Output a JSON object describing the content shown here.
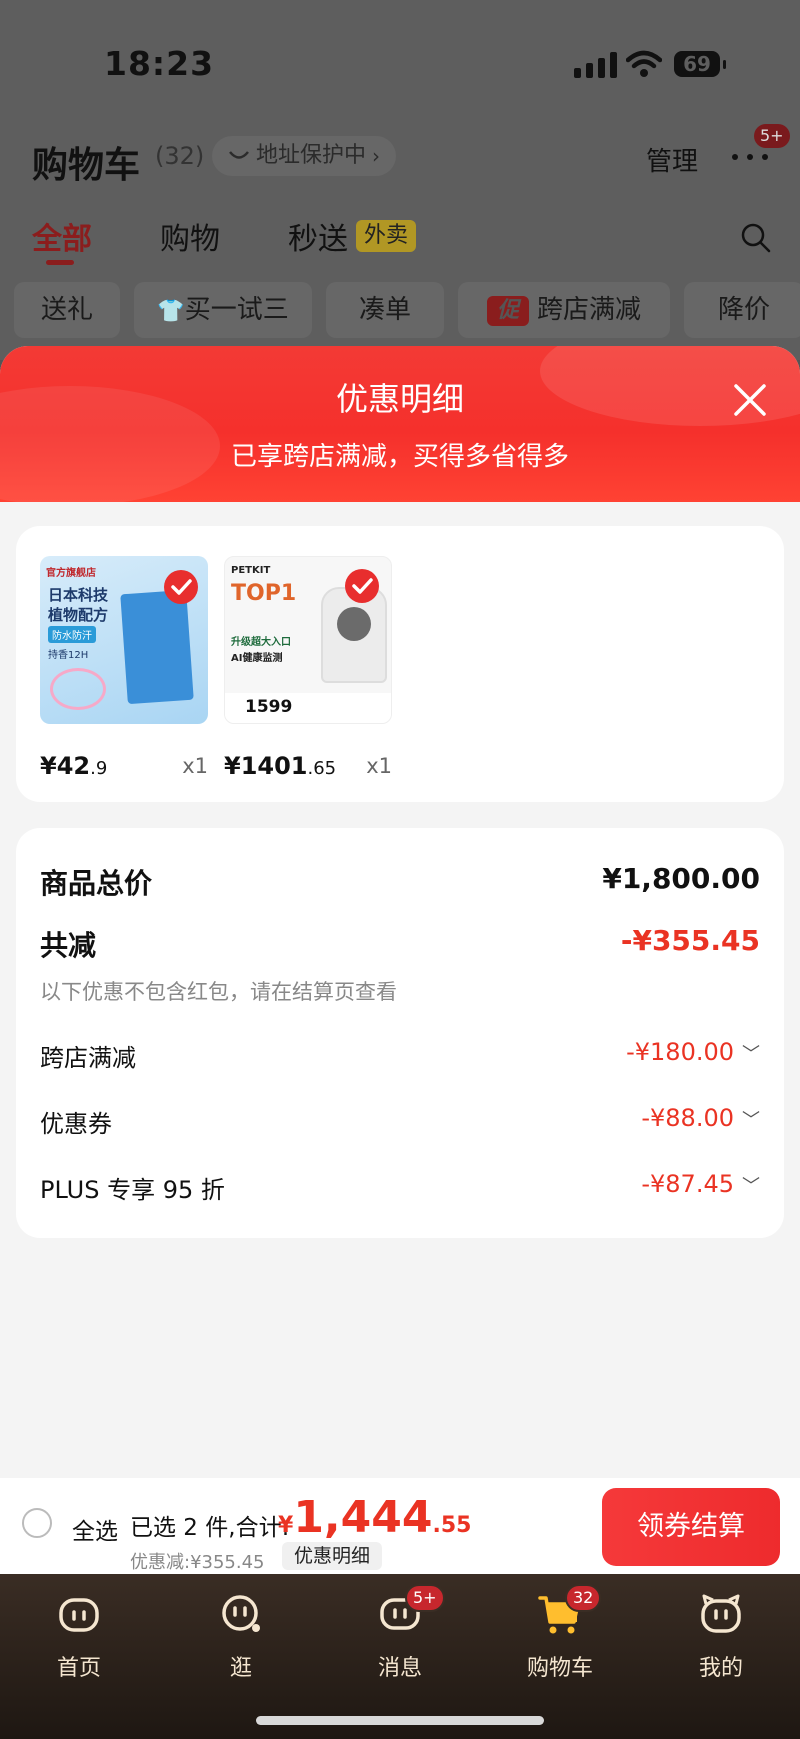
{
  "status_bar": {
    "time": "18:23",
    "battery": "69"
  },
  "header": {
    "title": "购物车",
    "count": "(32)",
    "address_pill": "地址保护中",
    "manage": "管理",
    "more_badge": "5+"
  },
  "tabs": [
    {
      "label": "全部",
      "active": true
    },
    {
      "label": "购物",
      "active": false
    },
    {
      "label": "秒送",
      "active": false
    }
  ],
  "waimai_tag": "外卖",
  "filters": [
    "送礼",
    "买一试三",
    "凑单",
    "跨店满减",
    "降价"
  ],
  "filter_promo_tag": "促",
  "sheet": {
    "title": "优惠明细",
    "subtitle": "已享跨店满减，买得多省得多"
  },
  "products": [
    {
      "price_int": "¥42",
      "price_dec": ".9",
      "qty": "x1",
      "image_texts": [
        "官方旗舰店",
        "日本科技",
        "植物配方",
        "防水防汗",
        "持香12H"
      ]
    },
    {
      "price_int": "¥1401",
      "price_dec": ".65",
      "qty": "x1",
      "image_texts": [
        "PETKIT",
        "TOP1",
        "升级超大入口",
        "AI健康监测",
        "1599"
      ]
    }
  ],
  "summary": {
    "goods_total_label": "商品总价",
    "goods_total_value": "¥1,800.00",
    "total_reduction_label": "共减",
    "total_reduction_value": "-¥355.45",
    "note": "以下优惠不包含红包，请在结算页查看",
    "items": [
      {
        "label": "跨店满减",
        "value": "-¥180.00"
      },
      {
        "label": "优惠券",
        "value": "-¥88.00"
      },
      {
        "label": "PLUS 专享 95 折",
        "value": "-¥87.45"
      }
    ]
  },
  "checkout": {
    "select_all": "全选",
    "selected_text": "已选 2 件,合计:",
    "total_yen": "¥",
    "total_int": "1,444",
    "total_dec": ".55",
    "saving": "优惠减:¥355.45",
    "detail_button": "优惠明细",
    "pay_button": "领券结算"
  },
  "tabbar": [
    {
      "label": "首页",
      "badge": ""
    },
    {
      "label": "逛",
      "badge": ""
    },
    {
      "label": "消息",
      "badge": "5+"
    },
    {
      "label": "购物车",
      "badge": "32"
    },
    {
      "label": "我的",
      "badge": ""
    }
  ],
  "colors": {
    "accent": "#ea3323",
    "header_red": "#f5302c",
    "tabbar_bg": "#2a2019"
  }
}
